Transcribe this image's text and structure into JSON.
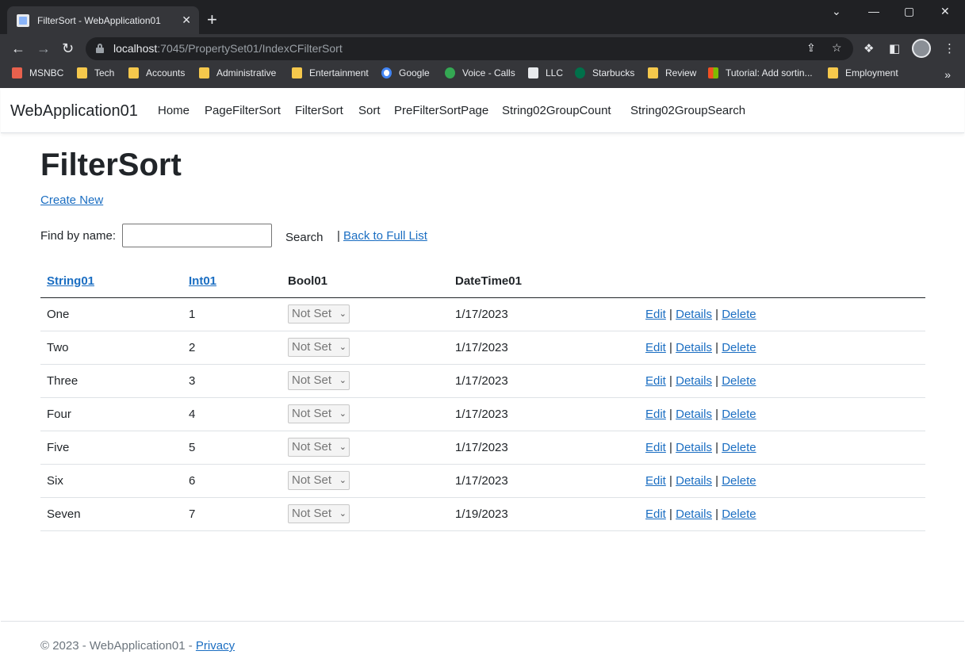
{
  "browser": {
    "tab_title": "FilterSort - WebApplication01",
    "tab_close": "✕",
    "new_tab": "+",
    "url_host": "localhost",
    "url_rest": ":7045/PropertySet01/IndexCFilterSort",
    "bookmarks": [
      "MSNBC",
      "Tech",
      "Accounts",
      "Administrative",
      "Entertainment",
      "Google",
      "Voice - Calls",
      "LLC",
      "Starbucks",
      "Review",
      "Tutorial: Add sortin...",
      "Employment"
    ],
    "bookmarks_more": "»"
  },
  "app": {
    "brand": "WebApplication01",
    "nav": [
      "Home",
      "PageFilterSort",
      "FilterSort",
      "Sort",
      "PreFilterSortPage",
      "String02GroupCount",
      "String02GroupSearch"
    ]
  },
  "main": {
    "title": "FilterSort",
    "create_new": "Create New",
    "find_label": "Find by name:",
    "search_value": "",
    "search_button": "Search",
    "separator": "|",
    "back_link": "Back to Full List"
  },
  "table": {
    "headers": [
      "String01",
      "Int01",
      "Bool01",
      "DateTime01"
    ],
    "rows": [
      {
        "string01": "One",
        "int01": "1",
        "bool01": "Not Set",
        "date": "1/17/2023"
      },
      {
        "string01": "Two",
        "int01": "2",
        "bool01": "Not Set",
        "date": "1/17/2023"
      },
      {
        "string01": "Three",
        "int01": "3",
        "bool01": "Not Set",
        "date": "1/17/2023"
      },
      {
        "string01": "Four",
        "int01": "4",
        "bool01": "Not Set",
        "date": "1/17/2023"
      },
      {
        "string01": "Five",
        "int01": "5",
        "bool01": "Not Set",
        "date": "1/17/2023"
      },
      {
        "string01": "Six",
        "int01": "6",
        "bool01": "Not Set",
        "date": "1/17/2023"
      },
      {
        "string01": "Seven",
        "int01": "7",
        "bool01": "Not Set",
        "date": "1/19/2023"
      }
    ],
    "actions": {
      "edit": "Edit",
      "details": "Details",
      "delete": "Delete",
      "sep": "|"
    }
  },
  "footer": {
    "text": "© 2023 - WebApplication01 - ",
    "privacy": "Privacy"
  },
  "colors": {
    "link": "#1b6ec2",
    "chrome_dark": "#202124",
    "chrome_mid": "#35363a"
  }
}
